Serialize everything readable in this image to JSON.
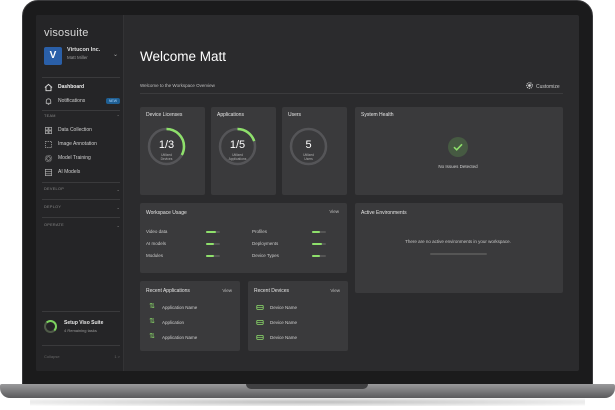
{
  "brand": "visosuite",
  "org": {
    "logo_letter": "V",
    "name": "Virtucon Inc.",
    "user": "Matt Miller"
  },
  "nav": {
    "dashboard": "Dashboard",
    "notifications": "Notifications",
    "notifications_badge": "NEW",
    "sections": {
      "team": "TEAM",
      "develop": "DEVELOP",
      "deploy": "DEPLOY",
      "operate": "OPERATE"
    },
    "team_items": [
      "Data Collection",
      "Image Annotation",
      "Model Training",
      "AI Models"
    ]
  },
  "setup": {
    "title": "Setup Viso Suite",
    "subtitle": "4 Remaining tasks",
    "progress_fraction": 0.5
  },
  "sidebar_footer": {
    "label": "Collapse",
    "pager": "1  >"
  },
  "main": {
    "title": "Welcome Matt",
    "overview": "Welcome to the Workspace Overview",
    "customize": "Customize"
  },
  "cards": {
    "device_licenses": {
      "title": "Device Licenses",
      "value": "1/3",
      "sub1": "Utilized",
      "sub2": "Devices",
      "fraction": 0.33
    },
    "applications": {
      "title": "Applications",
      "value": "1/5",
      "sub1": "Utilized",
      "sub2": "Applications",
      "fraction": 0.2
    },
    "users": {
      "title": "Users",
      "value": "5",
      "sub1": "Utilized",
      "sub2": "Users",
      "fraction": 0
    },
    "system_health": {
      "title": "System Health",
      "status": "No Issues Detected"
    },
    "workspace_usage": {
      "title": "Workspace Usage",
      "link": "View",
      "left": [
        {
          "label": "Video data",
          "fraction": 0.7
        },
        {
          "label": "AI models",
          "fraction": 0.55
        },
        {
          "label": "Modules",
          "fraction": 0.6
        }
      ],
      "right": [
        {
          "label": "Profiles",
          "fraction": 0.55
        },
        {
          "label": "Deployments",
          "fraction": 0.7
        },
        {
          "label": "Device Types",
          "fraction": 0.6
        }
      ]
    },
    "active_environments": {
      "title": "Active Environments",
      "message": "There are no active environments in your workspace."
    },
    "recent_applications": {
      "title": "Recent Applications",
      "link": "View",
      "items": [
        "Application Name",
        "Application",
        "Application Name"
      ]
    },
    "recent_devices": {
      "title": "Recent Devices",
      "link": "View",
      "items": [
        "Device Name",
        "Device Name",
        "Device Name"
      ]
    }
  },
  "colors": {
    "accent": "#8ee06b",
    "card": "#3a3a3c",
    "background": "#2b2b2d",
    "logo": "#2a5fa8"
  }
}
